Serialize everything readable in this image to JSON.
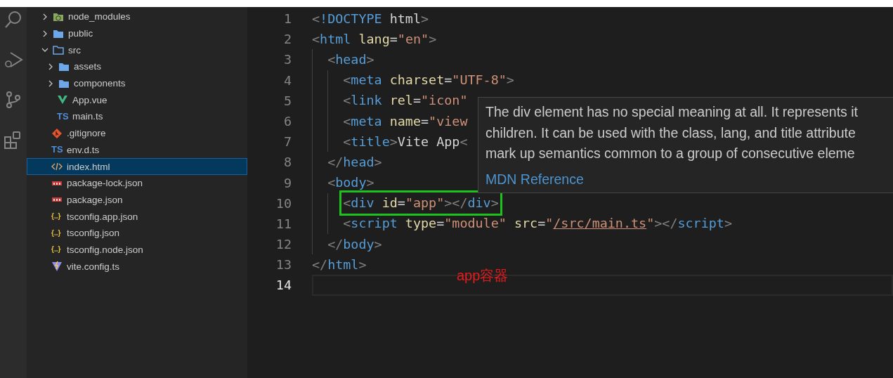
{
  "activity_bar": {
    "items": [
      {
        "kind": "search"
      },
      {
        "kind": "debug"
      },
      {
        "kind": "source-control"
      },
      {
        "kind": "extensions"
      }
    ]
  },
  "explorer": {
    "items": [
      {
        "label": "node_modules",
        "kind": "node",
        "expanded": false,
        "selected": false
      },
      {
        "label": "public",
        "kind": "folder",
        "expanded": false,
        "selected": false
      },
      {
        "label": "src",
        "kind": "folder",
        "expanded": true,
        "selected": false,
        "children": [
          {
            "label": "assets",
            "kind": "folder",
            "expanded": false,
            "selected": false
          },
          {
            "label": "components",
            "kind": "folder",
            "expanded": false,
            "selected": false
          },
          {
            "label": "App.vue",
            "kind": "vue",
            "selected": false
          },
          {
            "label": "main.ts",
            "kind": "ts",
            "badge": "TS",
            "selected": false
          }
        ]
      },
      {
        "label": ".gitignore",
        "kind": "git",
        "selected": false
      },
      {
        "label": "env.d.ts",
        "kind": "ts",
        "badge": "TS",
        "selected": false
      },
      {
        "label": "index.html",
        "kind": "html",
        "selected": true
      },
      {
        "label": "package-lock.json",
        "kind": "npm",
        "selected": false
      },
      {
        "label": "package.json",
        "kind": "npm",
        "selected": false
      },
      {
        "label": "tsconfig.app.json",
        "kind": "json",
        "badge": "{..}",
        "selected": false
      },
      {
        "label": "tsconfig.json",
        "kind": "json",
        "badge": "{..}",
        "selected": false
      },
      {
        "label": "tsconfig.node.json",
        "kind": "json",
        "badge": "{..}",
        "selected": false
      },
      {
        "label": "vite.config.ts",
        "kind": "vite",
        "selected": false
      }
    ]
  },
  "editor": {
    "lines": [
      {
        "number": "1",
        "current": false,
        "boxed": false,
        "tokens": [
          {
            "kind": "punct",
            "text": "<"
          },
          {
            "kind": "tag",
            "text": "!DOCTYPE"
          },
          {
            "kind": "text",
            "text": " html"
          },
          {
            "kind": "punct",
            "text": ">"
          }
        ]
      },
      {
        "number": "2",
        "current": false,
        "boxed": false,
        "tokens": [
          {
            "kind": "punct",
            "text": "<"
          },
          {
            "kind": "tag",
            "text": "html"
          },
          {
            "kind": "attr",
            "text": " lang"
          },
          {
            "kind": "eq",
            "text": "="
          },
          {
            "kind": "string",
            "text": "\"en\""
          },
          {
            "kind": "punct",
            "text": ">"
          }
        ],
        "children": [
          {
            "number": "3",
            "current": false,
            "boxed": false,
            "tokens": [
              {
                "kind": "punct",
                "text": "<"
              },
              {
                "kind": "tag",
                "text": "head"
              },
              {
                "kind": "punct",
                "text": ">"
              }
            ],
            "children": [
              {
                "number": "4",
                "current": false,
                "boxed": false,
                "tokens": [
                  {
                    "kind": "punct",
                    "text": "<"
                  },
                  {
                    "kind": "tag",
                    "text": "meta"
                  },
                  {
                    "kind": "attr",
                    "text": " charset"
                  },
                  {
                    "kind": "eq",
                    "text": "="
                  },
                  {
                    "kind": "string",
                    "text": "\"UTF-8\""
                  },
                  {
                    "kind": "punct",
                    "text": ">"
                  }
                ]
              },
              {
                "number": "5",
                "current": false,
                "boxed": false,
                "tokens": [
                  {
                    "kind": "punct",
                    "text": "<"
                  },
                  {
                    "kind": "tag",
                    "text": "link"
                  },
                  {
                    "kind": "attr",
                    "text": " rel"
                  },
                  {
                    "kind": "eq",
                    "text": "="
                  },
                  {
                    "kind": "string",
                    "text": "\"icon\""
                  }
                ]
              },
              {
                "number": "6",
                "current": false,
                "boxed": false,
                "tokens": [
                  {
                    "kind": "punct",
                    "text": "<"
                  },
                  {
                    "kind": "tag",
                    "text": "meta"
                  },
                  {
                    "kind": "attr",
                    "text": " name"
                  },
                  {
                    "kind": "eq",
                    "text": "="
                  },
                  {
                    "kind": "string",
                    "text": "\"view"
                  }
                ]
              },
              {
                "number": "7",
                "current": false,
                "boxed": false,
                "tokens": [
                  {
                    "kind": "punct",
                    "text": "<"
                  },
                  {
                    "kind": "tag",
                    "text": "title"
                  },
                  {
                    "kind": "punct",
                    "text": ">"
                  },
                  {
                    "kind": "text",
                    "text": "Vite App"
                  },
                  {
                    "kind": "punct",
                    "text": "<"
                  }
                ]
              }
            ]
          },
          {
            "number": "8",
            "current": false,
            "boxed": false,
            "tokens": [
              {
                "kind": "punct",
                "text": "</"
              },
              {
                "kind": "tag",
                "text": "head"
              },
              {
                "kind": "punct",
                "text": ">"
              }
            ]
          },
          {
            "number": "9",
            "current": false,
            "boxed": false,
            "tokens": [
              {
                "kind": "punct",
                "text": "<"
              },
              {
                "kind": "tag",
                "text": "body"
              },
              {
                "kind": "punct",
                "text": ">"
              }
            ],
            "children": [
              {
                "number": "10",
                "current": false,
                "boxed": true,
                "tokens": [
                  {
                    "kind": "punct",
                    "text": "<"
                  },
                  {
                    "kind": "tag",
                    "text": "div"
                  },
                  {
                    "kind": "attr",
                    "text": " id"
                  },
                  {
                    "kind": "eq",
                    "text": "="
                  },
                  {
                    "kind": "string",
                    "text": "\"app\""
                  },
                  {
                    "kind": "punct",
                    "text": "></"
                  },
                  {
                    "kind": "tag",
                    "text": "div"
                  },
                  {
                    "kind": "punct",
                    "text": ">"
                  }
                ]
              },
              {
                "number": "11",
                "current": false,
                "boxed": false,
                "tokens": [
                  {
                    "kind": "punct",
                    "text": "<"
                  },
                  {
                    "kind": "tag",
                    "text": "script"
                  },
                  {
                    "kind": "attr",
                    "text": " type"
                  },
                  {
                    "kind": "eq",
                    "text": "="
                  },
                  {
                    "kind": "string",
                    "text": "\"module\""
                  },
                  {
                    "kind": "attr",
                    "text": " src"
                  },
                  {
                    "kind": "eq",
                    "text": "="
                  },
                  {
                    "kind": "string",
                    "text": "\""
                  },
                  {
                    "kind": "link",
                    "text": "/src/main.ts"
                  },
                  {
                    "kind": "string",
                    "text": "\""
                  },
                  {
                    "kind": "punct",
                    "text": "></"
                  },
                  {
                    "kind": "tag",
                    "text": "script"
                  },
                  {
                    "kind": "punct",
                    "text": ">"
                  }
                ]
              }
            ]
          },
          {
            "number": "12",
            "current": false,
            "boxed": false,
            "tokens": [
              {
                "kind": "punct",
                "text": "</"
              },
              {
                "kind": "tag",
                "text": "body"
              },
              {
                "kind": "punct",
                "text": ">"
              }
            ]
          }
        ]
      },
      {
        "number": "13",
        "current": false,
        "boxed": false,
        "tokens": [
          {
            "kind": "punct",
            "text": "</"
          },
          {
            "kind": "tag",
            "text": "html"
          },
          {
            "kind": "punct",
            "text": ">"
          }
        ]
      },
      {
        "number": "14",
        "current": true,
        "boxed": false
      }
    ],
    "hover": {
      "lines": [
        "The div element has no special meaning at all. It represents it",
        "children. It can be used with the class, lang, and title attribute",
        "mark up semantics common to a group of consecutive eleme"
      ],
      "link": "MDN Reference"
    },
    "annotation": "app容器"
  }
}
